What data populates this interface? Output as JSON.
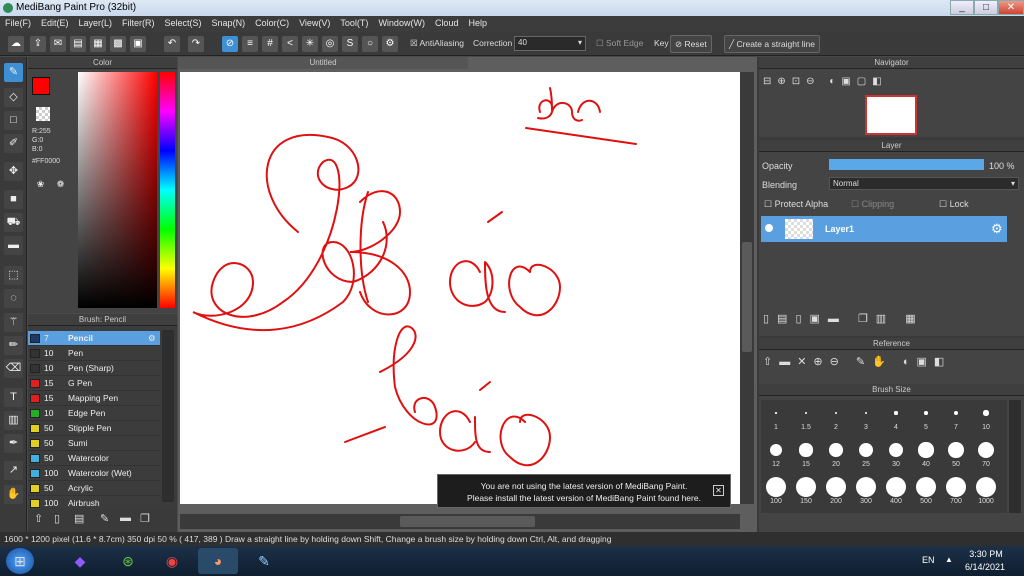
{
  "window": {
    "title": "MediBang Paint Pro (32bit)",
    "min": "_",
    "max": "□",
    "close": "✕"
  },
  "menu": [
    "File(F)",
    "Edit(E)",
    "Layer(L)",
    "Filter(R)",
    "Select(S)",
    "Snap(N)",
    "Color(C)",
    "View(V)",
    "Tool(T)",
    "Window(W)",
    "Cloud",
    "Help"
  ],
  "toolbar": {
    "antialias": "AntiAliasing",
    "correction_label": "Correction",
    "correction_value": "40",
    "soft_edge": "Soft Edge",
    "key_label": "Key",
    "reset": "Reset",
    "straight_line": "Create a straight line"
  },
  "color_panel": {
    "title": "Color",
    "r": "R:255",
    "g": "G:0",
    "b": "B:0",
    "hex": "#FF0000",
    "fg": "#ff0000"
  },
  "brush_panel": {
    "title": "Brush: Pencil",
    "brushes": [
      {
        "size": "7",
        "name": "Pencil",
        "color": "#1f3a66",
        "selected": true
      },
      {
        "size": "10",
        "name": "Pen",
        "color": "#333333"
      },
      {
        "size": "10",
        "name": "Pen (Sharp)",
        "color": "#333333"
      },
      {
        "size": "15",
        "name": "G Pen",
        "color": "#e02020"
      },
      {
        "size": "15",
        "name": "Mapping Pen",
        "color": "#e02020"
      },
      {
        "size": "10",
        "name": "Edge Pen",
        "color": "#20b020"
      },
      {
        "size": "50",
        "name": "Stipple Pen",
        "color": "#e0d020"
      },
      {
        "size": "50",
        "name": "Sumi",
        "color": "#e0d020"
      },
      {
        "size": "50",
        "name": "Watercolor",
        "color": "#40b0e0"
      },
      {
        "size": "100",
        "name": "Watercolor (Wet)",
        "color": "#40b0e0"
      },
      {
        "size": "50",
        "name": "Acrylic",
        "color": "#e0d020"
      },
      {
        "size": "100",
        "name": "Airbrush",
        "color": "#e0d020"
      }
    ]
  },
  "canvas": {
    "tab": "Untitled"
  },
  "notice": {
    "line1": "You are not using the latest version of MediBang Paint.",
    "line2": "Please install the latest version of MediBang Paint found here.",
    "close": "✕"
  },
  "navigator": {
    "title": "Navigator"
  },
  "layer_panel": {
    "title": "Layer",
    "opacity_label": "Opacity",
    "opacity_value": "100 %",
    "opacity": 1.0,
    "blending_label": "Blending",
    "blending_value": "Normal",
    "protect_alpha": "Protect Alpha",
    "clipping": "Clipping",
    "lock": "Lock",
    "layer_name": "Layer1"
  },
  "reference": {
    "title": "Reference"
  },
  "brush_size": {
    "title": "Brush Size",
    "sizes": [
      "1",
      "1.5",
      "2",
      "3",
      "4",
      "5",
      "7",
      "10",
      "12",
      "15",
      "20",
      "25",
      "30",
      "40",
      "50",
      "70",
      "100",
      "150",
      "200",
      "300",
      "400",
      "500",
      "700",
      "1000"
    ]
  },
  "status": {
    "text": "1600 * 1200 pixel  (11.6 * 8.7cm)  350 dpi  50 %  ( 417, 389 )  Draw a straight line by holding down Shift, Change a brush size by holding down Ctrl, Alt, and dragging"
  },
  "taskbar": {
    "lang": "EN",
    "time": "3:30 PM",
    "date": "6/14/2021"
  }
}
